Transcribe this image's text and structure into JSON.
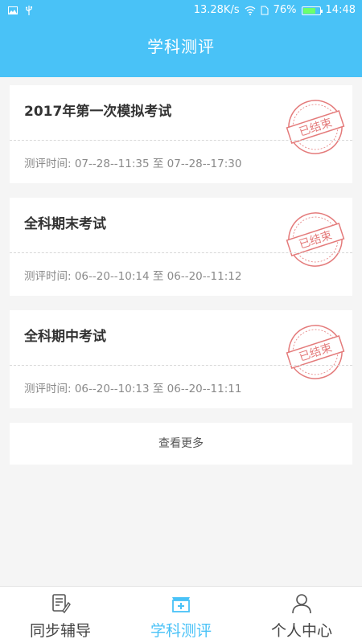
{
  "status_bar": {
    "speed": "13.28K/s",
    "battery": "76%",
    "battery_level": 0.76,
    "time": "14:48"
  },
  "header": {
    "title": "学科测评"
  },
  "exams": [
    {
      "name": "2017年第一次模拟考试",
      "time": "测评时间: 07--28--11:35 至 07--28--17:30",
      "stamp": "已结束"
    },
    {
      "name": "全科期末考试",
      "time": "测评时间: 06--20--10:14 至 06--20--11:12",
      "stamp": "已结束"
    },
    {
      "name": "全科期中考试",
      "time": "测评时间: 06--20--10:13 至 06--20--11:11",
      "stamp": "已结束"
    }
  ],
  "more_label": "查看更多",
  "nav": [
    {
      "label": "同步辅导",
      "icon": "document-edit-icon"
    },
    {
      "label": "学科测评",
      "icon": "medical-kit-icon"
    },
    {
      "label": "个人中心",
      "icon": "person-icon"
    }
  ],
  "colors": {
    "accent": "#49c2f7",
    "stamp": "#e47b7b"
  }
}
